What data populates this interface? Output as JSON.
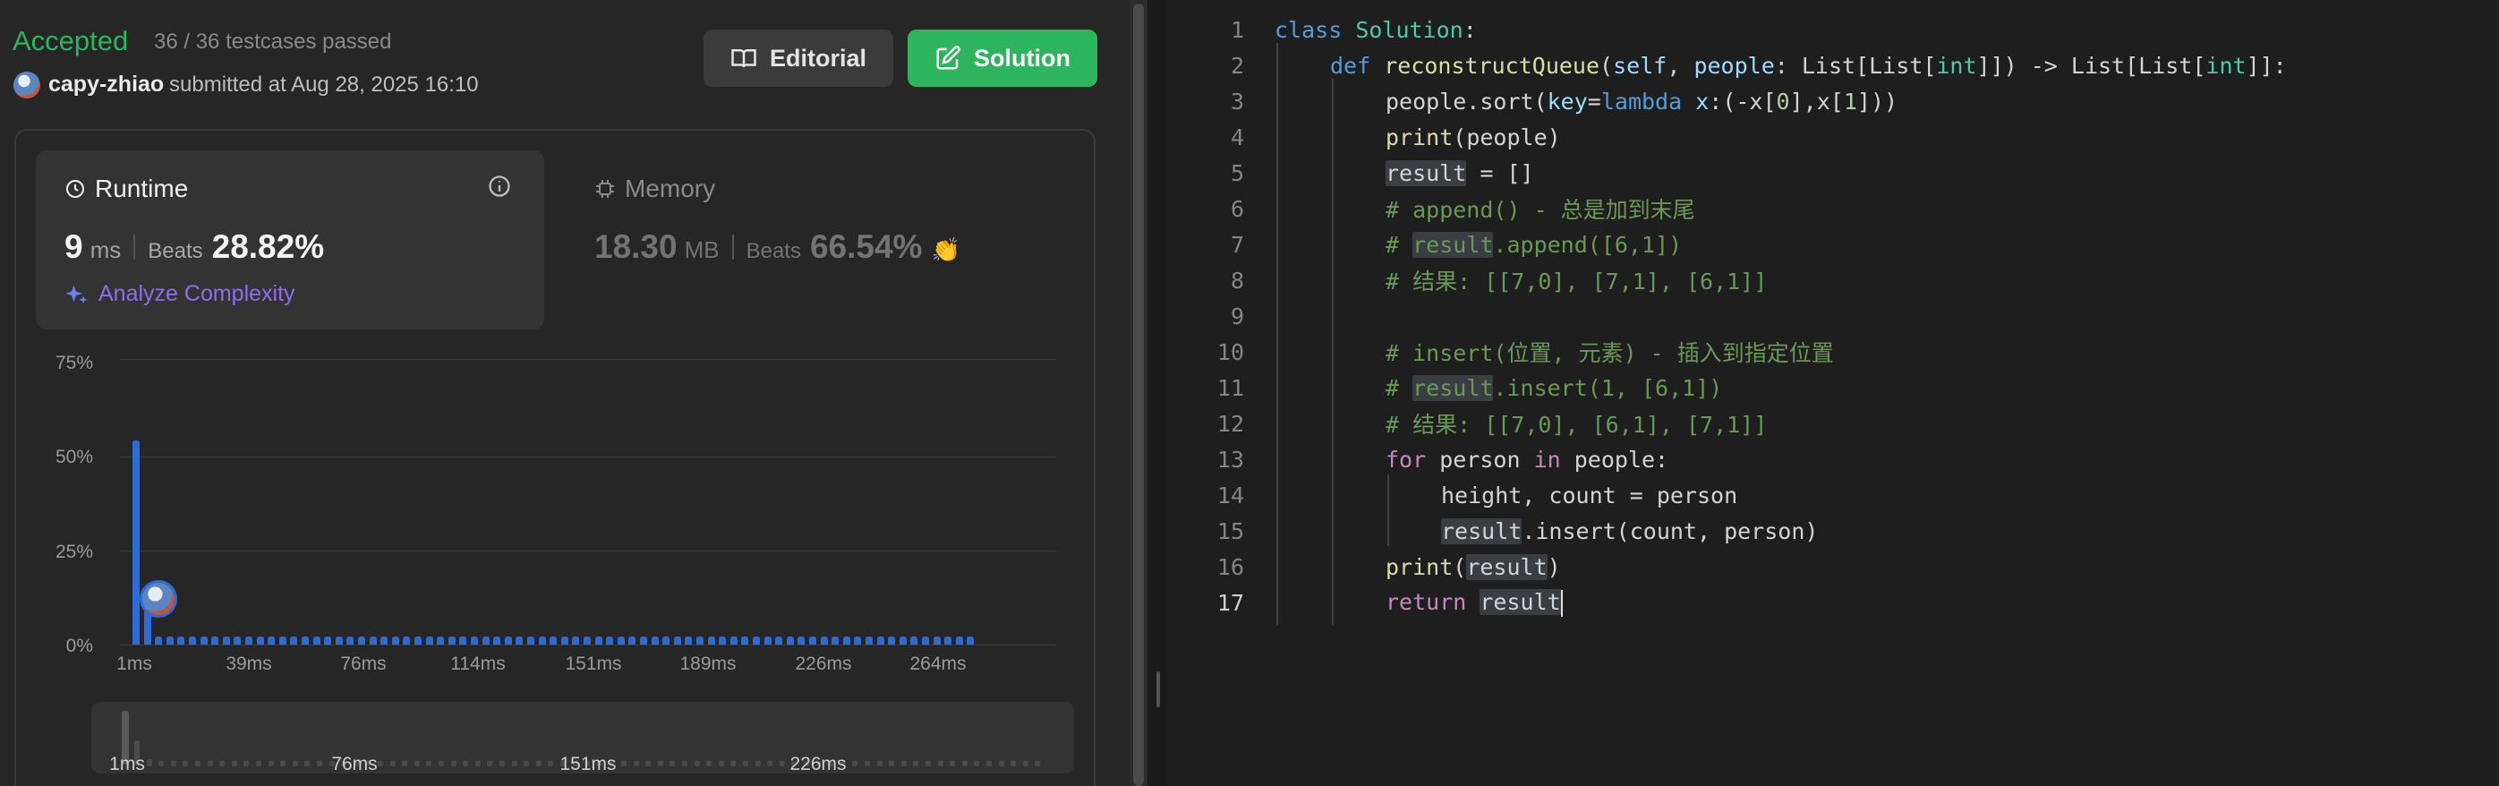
{
  "result": {
    "status": "Accepted",
    "testcases": "36 / 36 testcases passed",
    "author": "capy-zhiao",
    "submitted": "submitted at Aug 28, 2025 16:10"
  },
  "buttons": {
    "editorial": "Editorial",
    "solution": "Solution"
  },
  "runtime": {
    "title": "Runtime",
    "value": "9",
    "unit": "ms",
    "beats_label": "Beats",
    "beats": "28.82%",
    "analyze": "Analyze Complexity"
  },
  "memory": {
    "title": "Memory",
    "value": "18.30",
    "unit": "MB",
    "beats_label": "Beats",
    "beats": "66.54%"
  },
  "colors": {
    "accent_green": "#2db55d",
    "bar_blue": "#2a6cdc",
    "purple": "#8f6cf0"
  },
  "chart_data": {
    "type": "bar",
    "y_ticks": [
      "75%",
      "50%",
      "25%",
      "0%"
    ],
    "ylim": [
      0,
      75
    ],
    "x_ticks": [
      "1ms",
      "39ms",
      "76ms",
      "114ms",
      "151ms",
      "189ms",
      "226ms",
      "264ms"
    ],
    "series": [
      {
        "values": [
          53.5,
          14.5,
          2,
          2,
          2,
          2,
          2,
          2,
          2,
          2,
          2,
          2,
          2,
          2,
          2,
          2,
          2,
          2,
          2,
          2,
          2,
          2,
          2,
          2,
          2,
          2,
          2,
          2,
          2,
          2,
          2,
          2,
          2,
          2,
          2,
          2,
          2,
          2,
          2,
          2,
          2,
          2,
          2,
          2,
          2,
          2,
          2,
          2,
          2,
          2,
          2,
          2,
          2,
          2,
          2,
          2,
          2,
          2,
          2,
          2,
          2,
          2,
          2,
          2,
          2,
          2,
          2,
          2,
          2,
          2,
          2,
          2,
          2,
          2,
          2
        ]
      }
    ],
    "grid": true,
    "mini_x_ticks": [
      "1ms",
      "76ms",
      "151ms",
      "226ms"
    ]
  },
  "editor": {
    "lines": [
      {
        "n": "1"
      },
      {
        "n": "2"
      },
      {
        "n": "3"
      },
      {
        "n": "4"
      },
      {
        "n": "5"
      },
      {
        "n": "6"
      },
      {
        "n": "7"
      },
      {
        "n": "8"
      },
      {
        "n": "9"
      },
      {
        "n": "10"
      },
      {
        "n": "11"
      },
      {
        "n": "12"
      },
      {
        "n": "13"
      },
      {
        "n": "14"
      },
      {
        "n": "15"
      },
      {
        "n": "16"
      },
      {
        "n": "17"
      }
    ],
    "tok": {
      "l1_class": "class",
      "l1_name": "Solution",
      "l1_colon": ":",
      "l2_def": "def",
      "l2_fn": "reconstructQueue",
      "l2_open": "(",
      "l2_self": "self",
      "l2_c1": ", ",
      "l2_people": "people",
      "l2_c2": ": List[List[",
      "l2_int1": "int",
      "l2_c3": "]]) -> List[List[",
      "l2_int2": "int",
      "l2_c4": "]]:",
      "l3_a": "people.sort(",
      "l3_key": "key",
      "l3_eq": "=",
      "l3_lambda": "lambda",
      "l3_sp": " ",
      "l3_x": "x",
      "l3_b": ":(-x[",
      "l3_n0": "0",
      "l3_c": "],x[",
      "l3_n1": "1",
      "l3_d": "]))",
      "l4_print": "print",
      "l4_rest": "(people)",
      "l5_result": "result",
      "l5_rest": " = []",
      "l6": "# append() - 总是加到末尾",
      "l7_hash": "# ",
      "l7_result": "result",
      "l7_rest": ".append([6,1])",
      "l8": "# 结果: [[7,0], [7,1], [6,1]]",
      "l10": "# insert(位置, 元素) - 插入到指定位置",
      "l11_hash": "# ",
      "l11_result": "result",
      "l11_rest": ".insert(1, [6,1])",
      "l12": "# 结果: [[7,0], [6,1], [7,1]]",
      "l13_for": "for",
      "l13_a": " person ",
      "l13_in": "in",
      "l13_b": " people:",
      "l14": "height, count = person",
      "l15_result": "result",
      "l15_rest": ".insert(count, person)",
      "l16_print": "print",
      "l16_open": "(",
      "l16_result": "result",
      "l16_close": ")",
      "l17_return": "return",
      "l17_sp": " ",
      "l17_result": "result"
    }
  }
}
